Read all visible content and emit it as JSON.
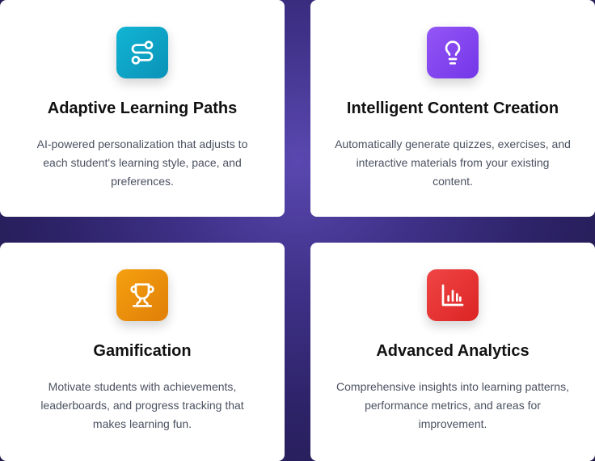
{
  "cards": [
    {
      "icon": "route-icon",
      "color": "#0ea5c9",
      "title": "Adaptive Learning Paths",
      "description": "AI-powered personalization that adjusts to each student's learning style, pace, and preferences."
    },
    {
      "icon": "lightbulb-icon",
      "color": "#8347f2",
      "title": "Intelligent Content Creation",
      "description": "Automatically generate quizzes, exercises, and interactive materials from your existing content."
    },
    {
      "icon": "trophy-icon",
      "color": "#f09610",
      "title": "Gamification",
      "description": "Motivate students with achievements, leaderboards, and progress tracking that makes learning fun."
    },
    {
      "icon": "bar-chart-icon",
      "color": "#e83535",
      "title": "Advanced Analytics",
      "description": "Comprehensive insights into learning patterns, performance metrics, and areas for improvement."
    }
  ]
}
